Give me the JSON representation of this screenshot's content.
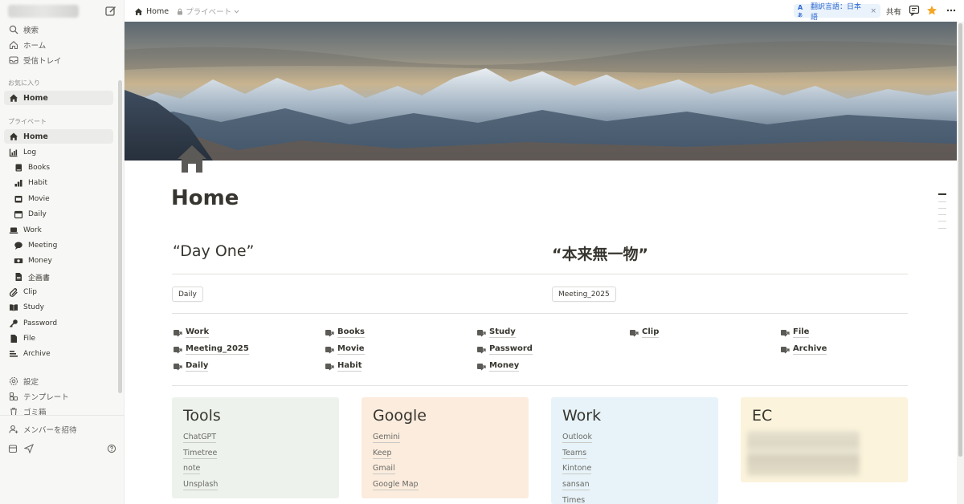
{
  "sidebar": {
    "top": [
      {
        "label": "検索",
        "icon": "search-icon"
      },
      {
        "label": "ホーム",
        "icon": "home-outline-icon"
      },
      {
        "label": "受信トレイ",
        "icon": "inbox-icon"
      }
    ],
    "favorites_label": "お気に入り",
    "favorites": [
      {
        "label": "Home",
        "icon": "home-icon"
      }
    ],
    "private_label": "プライベート",
    "tree": [
      {
        "label": "Home",
        "icon": "home-icon",
        "level": 0
      },
      {
        "label": "Log",
        "icon": "chart-icon",
        "level": 0
      },
      {
        "label": "Books",
        "icon": "book-icon",
        "level": 1
      },
      {
        "label": "Habit",
        "icon": "bar-chart-icon",
        "level": 1
      },
      {
        "label": "Movie",
        "icon": "movie-icon",
        "level": 1
      },
      {
        "label": "Daily",
        "icon": "calendar-icon",
        "level": 1
      },
      {
        "label": "Work",
        "icon": "laptop-icon",
        "level": 0
      },
      {
        "label": "Meeting",
        "icon": "chat-bubble-icon",
        "level": 1
      },
      {
        "label": "Money",
        "icon": "money-icon",
        "level": 1
      },
      {
        "label": "企画書",
        "icon": "document-icon",
        "level": 1
      },
      {
        "label": "Clip",
        "icon": "paperclip-icon",
        "level": 0
      },
      {
        "label": "Study",
        "icon": "open-book-icon",
        "level": 0
      },
      {
        "label": "Password",
        "icon": "key-icon",
        "level": 0
      },
      {
        "label": "File",
        "icon": "file-icon",
        "level": 0
      },
      {
        "label": "Archive",
        "icon": "archive-icon",
        "level": 0
      }
    ],
    "bottom": [
      {
        "label": "設定",
        "icon": "gear-icon"
      },
      {
        "label": "テンプレート",
        "icon": "template-icon"
      },
      {
        "label": "ゴミ箱",
        "icon": "trash-icon"
      }
    ],
    "invite": "メンバーを招待"
  },
  "topbar": {
    "breadcrumb": "Home",
    "private": "プライベート",
    "translate": "翻訳言語：日本語",
    "translate_close": "×",
    "share": "共有"
  },
  "page": {
    "title": "Home",
    "quote_left": "“Day One”",
    "quote_right": "“本来無一物”",
    "chip_left": "Daily",
    "chip_right": "Meeting_2025",
    "links": [
      [
        "Work",
        "Meeting_2025",
        "Daily"
      ],
      [
        "Books",
        "Movie",
        "Habit"
      ],
      [
        "Study",
        "Password",
        "Money"
      ],
      [
        "Clip"
      ],
      [
        "File",
        "Archive"
      ]
    ],
    "cards": [
      {
        "title": "Tools",
        "bg": "#edf3ec",
        "items": [
          "ChatGPT",
          "Timetree",
          "note",
          "Unsplash"
        ]
      },
      {
        "title": "Google",
        "bg": "#fbecdd",
        "items": [
          "Gemini",
          "Keep",
          "Gmail",
          "Google Map"
        ]
      },
      {
        "title": "Work",
        "bg": "#e7f3f8",
        "items": [
          "Outlook",
          "Teams",
          "Kintone",
          "sansan",
          "Times"
        ]
      },
      {
        "title": "EC",
        "bg": "#fbf3db",
        "items": []
      }
    ]
  },
  "colors": {
    "accent": "#2f6ad0",
    "star": "#f5a623",
    "sidebar_bg": "#f7f7f5"
  }
}
